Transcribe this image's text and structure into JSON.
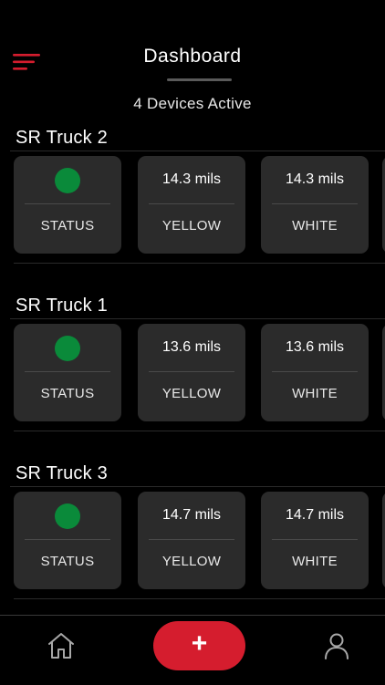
{
  "header": {
    "title": "Dashboard",
    "active_count": "4 Devices Active"
  },
  "colors": {
    "accent": "#d51d2e",
    "status_ok": "#0a8a3a",
    "card_bg": "#2b2b2b",
    "background": "#000000"
  },
  "devices": [
    {
      "name": "SR Truck 2",
      "status_label": "STATUS",
      "yellow_value": "14.3 mils",
      "yellow_label": "YELLOW",
      "white_value": "14.3 mils",
      "white_label": "WHITE"
    },
    {
      "name": "SR Truck 1",
      "status_label": "STATUS",
      "yellow_value": "13.6 mils",
      "yellow_label": "YELLOW",
      "white_value": "13.6 mils",
      "white_label": "WHITE"
    },
    {
      "name": "SR Truck 3",
      "status_label": "STATUS",
      "yellow_value": "14.7 mils",
      "yellow_label": "YELLOW",
      "white_value": "14.7 mils",
      "white_label": "WHITE"
    }
  ],
  "tabbar": {
    "home_icon": "home-icon",
    "add_icon": "plus-icon",
    "add_glyph": "+",
    "profile_icon": "user-icon"
  }
}
